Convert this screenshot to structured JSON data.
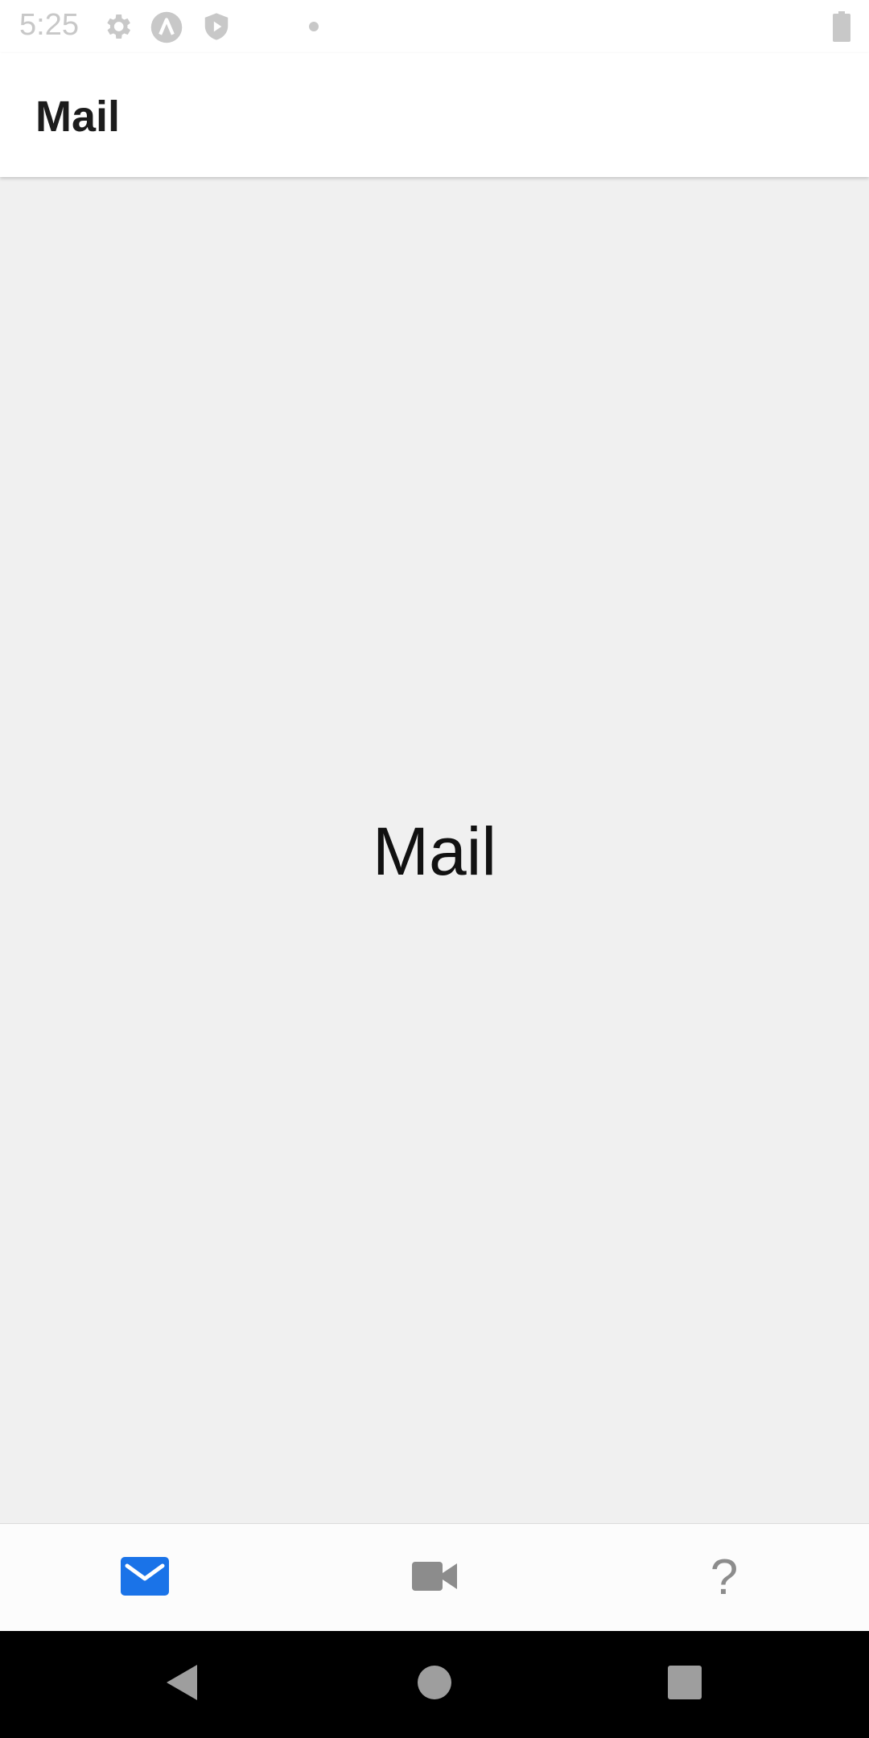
{
  "status_bar": {
    "time": "5:25",
    "icons": [
      "gear-icon",
      "a-circle-icon",
      "shield-play-icon",
      "dot-icon",
      "battery-icon"
    ]
  },
  "app_bar": {
    "title": "Mail"
  },
  "content": {
    "text": "Mail"
  },
  "tab_bar": {
    "tabs": [
      {
        "name": "mail",
        "icon": "mail-icon",
        "active": true,
        "color": "#1a73e8"
      },
      {
        "name": "video",
        "icon": "video-camera-icon",
        "active": false,
        "color": "#8c8c8c"
      },
      {
        "name": "help",
        "icon": "question-mark-icon",
        "active": false,
        "color": "#8c8c8c",
        "glyph": "?"
      }
    ]
  },
  "nav_bar": {
    "buttons": [
      "back-icon",
      "home-icon",
      "recents-icon"
    ]
  },
  "colors": {
    "accent": "#1a73e8",
    "inactive": "#8c8c8c",
    "background": "#f0f0f0"
  }
}
